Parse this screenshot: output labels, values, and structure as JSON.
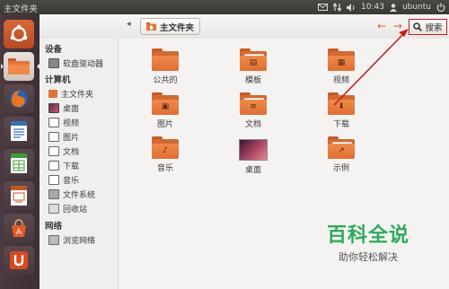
{
  "topbar": {
    "title": "主文件夹",
    "clock": "10:43",
    "user": "ubuntu"
  },
  "launcher": {
    "items": [
      {
        "name": "dash-home-icon",
        "color": "#c9572b"
      },
      {
        "name": "files-icon",
        "color": "#d4632d"
      },
      {
        "name": "firefox-icon",
        "color": "#e87a1e"
      },
      {
        "name": "writer-icon",
        "color": "#3a6fb4"
      },
      {
        "name": "calc-icon",
        "color": "#3f9a3a"
      },
      {
        "name": "impress-icon",
        "color": "#c0562c"
      },
      {
        "name": "software-center-icon",
        "color": "#e05a2a"
      },
      {
        "name": "ubuntu-one-icon",
        "color": "#d94a1d"
      }
    ]
  },
  "toolbar": {
    "location": "主文件夹",
    "search": "搜索"
  },
  "sidebar": {
    "devices_header": "设备",
    "devices": [
      {
        "label": "软盘驱动器",
        "icon": "floppy-icon",
        "color": "#777777"
      }
    ],
    "computer_header": "计算机",
    "computer": [
      {
        "label": "主文件夹",
        "icon": "home-folder-icon",
        "color": "#d4632d"
      },
      {
        "label": "桌面",
        "icon": "desktop-icon",
        "color": "#8a3b5e"
      },
      {
        "label": "视频",
        "icon": "videos-icon",
        "color": "#555555"
      },
      {
        "label": "图片",
        "icon": "pictures-icon",
        "color": "#555555"
      },
      {
        "label": "文档",
        "icon": "documents-icon",
        "color": "#555555"
      },
      {
        "label": "下载",
        "icon": "downloads-icon",
        "color": "#555555"
      },
      {
        "label": "音乐",
        "icon": "music-icon",
        "color": "#555555"
      },
      {
        "label": "文件系统",
        "icon": "filesystem-icon",
        "color": "#777777"
      },
      {
        "label": "回收站",
        "icon": "trash-icon",
        "color": "#777777"
      }
    ],
    "network_header": "网络",
    "network": [
      {
        "label": "浏览网络",
        "icon": "network-icon",
        "color": "#777777"
      }
    ]
  },
  "files": [
    {
      "label": "公共的",
      "icon": "public-folder-icon",
      "glyph": ""
    },
    {
      "label": "模板",
      "icon": "templates-folder-icon",
      "glyph": "▤"
    },
    {
      "label": "视频",
      "icon": "videos-folder-icon",
      "glyph": "▦"
    },
    {
      "label": "图片",
      "icon": "pictures-folder-icon",
      "glyph": "▣"
    },
    {
      "label": "文档",
      "icon": "documents-folder-icon",
      "glyph": "≡"
    },
    {
      "label": "下载",
      "icon": "downloads-folder-icon",
      "glyph": "⬇"
    },
    {
      "label": "音乐",
      "icon": "music-folder-icon",
      "glyph": "♪"
    },
    {
      "label": "桌面",
      "icon": "desktop-folder-icon",
      "glyph": ""
    },
    {
      "label": "示例",
      "icon": "examples-folder-icon",
      "glyph": "↗"
    }
  ],
  "watermark": {
    "title": "百科全说",
    "subtitle": "助你轻松解决"
  },
  "colors": {
    "accent": "#d4632d",
    "annotation": "#c42020",
    "watermark": "#2eaa5c"
  }
}
